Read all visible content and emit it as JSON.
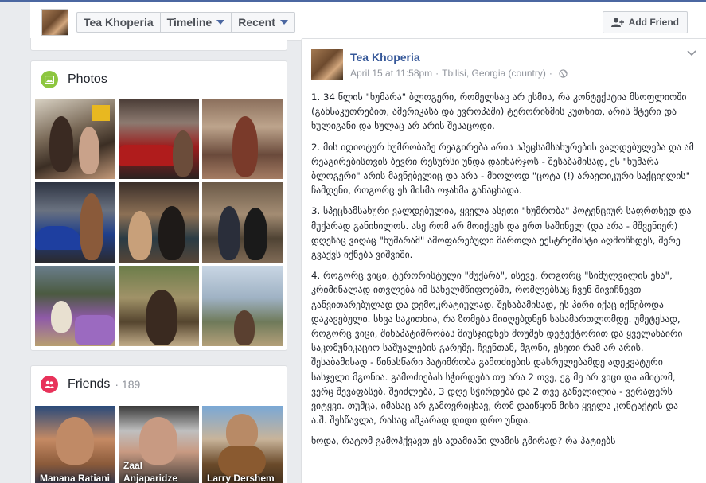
{
  "header": {
    "profile_name": "Tea Khoperia",
    "timeline_label": "Timeline",
    "recent_label": "Recent",
    "add_friend_label": "Add Friend"
  },
  "photos": {
    "title": "Photos",
    "count": 9
  },
  "friends": {
    "title": "Friends",
    "count": "· 189",
    "items": [
      {
        "name": "Manana Ratiani"
      },
      {
        "name": "Zaal Anjaparidze"
      },
      {
        "name": "Larry Dershem"
      }
    ]
  },
  "post": {
    "author": "Tea Khoperia",
    "date": "April 15 at 11:58pm",
    "location": "Tbilisi, Georgia (country)",
    "paragraphs": [
      "1. 34 წლის \"ხუმარა\" ბლოგერი, რომელსაც არ ესმის, რა კონტექსტია მსოფლიოში (განსაკუთრებით, ამერიკასა და ევროპაში) ტერორიზმის კუთხით, არის შტერი და ხულიგანი და სულაც არ არის შესაცოდი.",
      "2. მის იდიოტურ ხუმრობაზე რეაგირება არის სპეცსამსახურების ვალდებულება და ამ რეაგირებისთვის ბევრი რესურსი უნდა დაიხარჯოს - შესაბამისად, ეს \"ხუმარა ბლოგერი\" არის მავნებელიც და არა - მხოლოდ \"ცოტა (!) არაეთიკური საქციელის\" ჩამდენი, როგორც ეს მისმა ოჯახმა განაცხადა.",
      "3. სპეცსამსახური ვალდებულია, ყველა ასეთი \"ხუმრობა\" პოტენციურ საფრთხედ და მუქარად განიხილოს. ასე რომ არ მოიქცეს და ერთ საშინელ (და არა - მშვენიერ) დღესაც ვიღაც \"ხუმარამ\" ამოფარებული მართლა ექსტრემისტი აღმოჩნდეს, მერე გვაქვს იქნება ვიშვიში.",
      "4. როგორც ვიცი, ტერორისტული \"მუქარა\", ისევე, როგორც \"სიმულვილის ენა\", კრიმინალად ითვლება იმ სახელმწიფოებში, რომლებსაც ჩვენ მივიჩნევთ განვითარებულად და დემოკრატიულად. შესაბამისად, ეს პირი იქაც იქნებოდა დაკავებული. სხვა საკითხია, რა ზომებს მიიღებდნენ სასამართლომდე. უმეტესად, როგორც ვიცი, შინაპატიმრობას მიუსჯიდნენ მოუშენ დეტექტორით და ყველანაირი საკომუნიკაციო საშუალების გარეშე. ჩვენთან, მგონი, ესეთი რამ არ არის. შესაბამისად - წინასწარი პატიმრობა გამოძიების დასრულებამდე ადეკვატური სასჯელი მგონია. გამოძიებას სჭირდება თუ არა 2 თვე, ეგ მე არ ვიცი და ამიტომ, ვერც შევაფასებ. შეიძლება, 3 დღე სჭირდება და 2 თვე გაწელილია - ვერაფერს ვიტყვი. თუმცა, იმასაც არ გამოვრიცხავ, რომ დაიწყონ მისი ყველა კონტაქტის და ა.შ. შესწავლა, რასაც აშკარად დიდი დრო უნდა.",
      "ხოდა, რატომ გამოჰქვავთ ეს ადამიანი ლამის გმირად? რა პატიებს"
    ]
  }
}
